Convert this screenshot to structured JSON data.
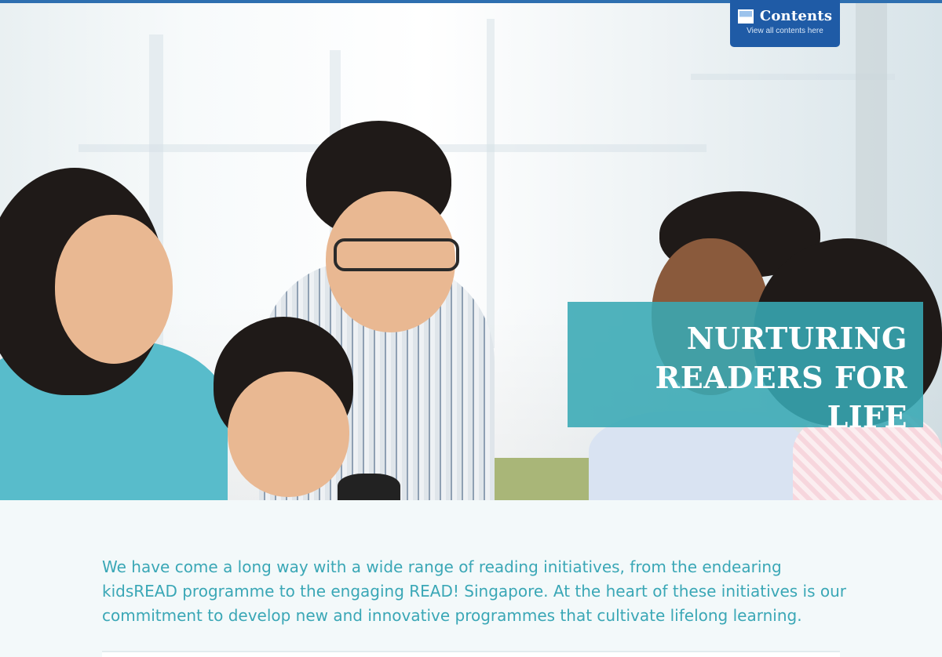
{
  "contents_tab": {
    "title": "Contents",
    "subtitle": "View all contents here",
    "icon": "contents-icon"
  },
  "hero": {
    "headline_line1": "NURTURING",
    "headline_line2": "READERS FOR LIFE"
  },
  "intro": {
    "text": "We have come a long way with a wide range of reading initiatives, from the endearing kidsREAD programme to the engaging READ! Singapore. At the heart of these initiatives is our commitment to develop new and innovative programmes that cultivate lifelong learning."
  },
  "colors": {
    "top_rule": "#2e6fb0",
    "contents_tab": "#1f5ba6",
    "headline_box": "#38a8b4",
    "intro_text": "#3aa7b6",
    "page_background": "#f3f9fa"
  }
}
